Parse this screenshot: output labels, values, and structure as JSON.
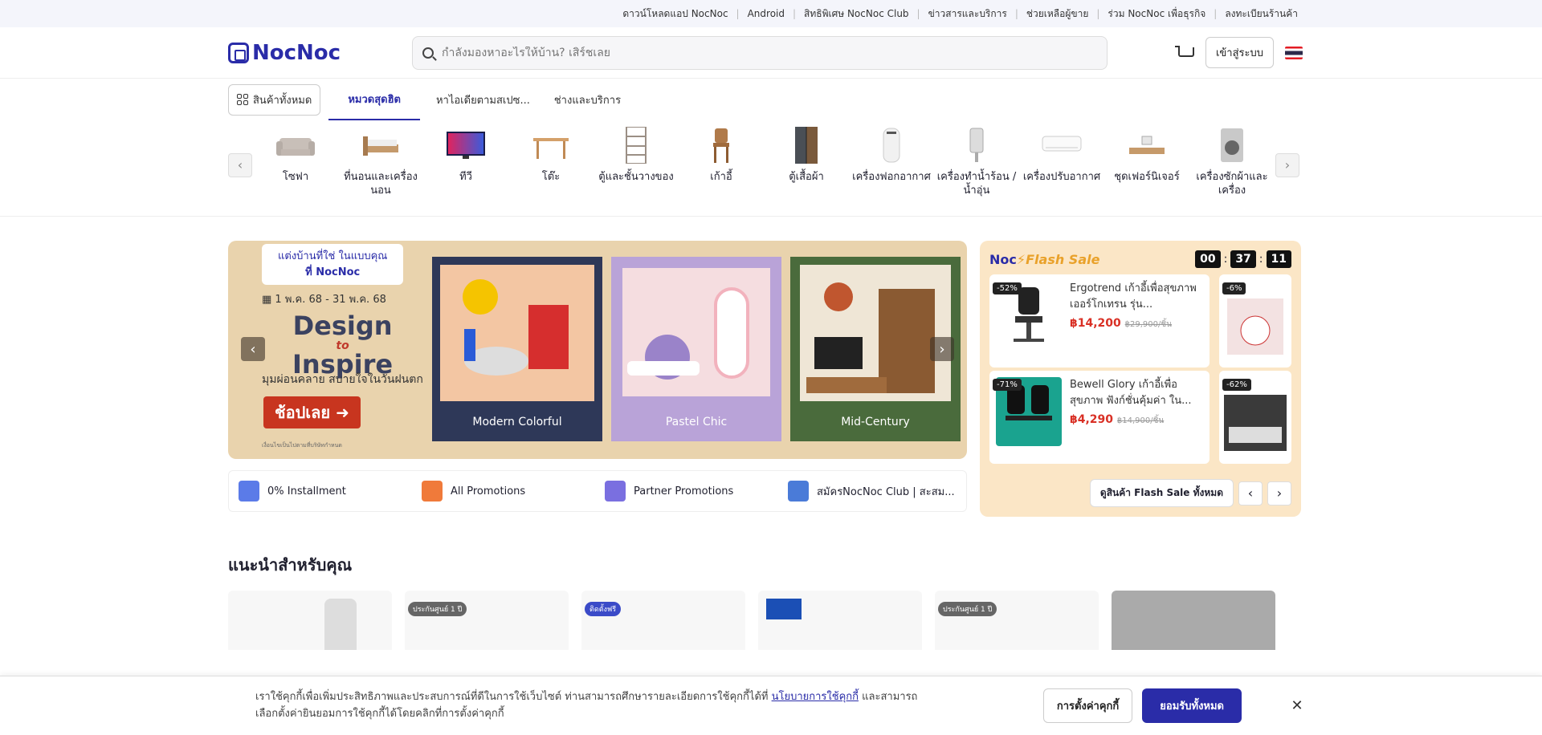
{
  "topbar": {
    "links": [
      "ดาวน์โหลดแอป NocNoc",
      "Android",
      "สิทธิพิเศษ NocNoc Club",
      "ข่าวสารและบริการ",
      "ช่วยเหลือผู้ขาย",
      "ร่วม NocNoc เพื่อธุรกิจ",
      "ลงทะเบียนร้านค้า"
    ]
  },
  "header": {
    "logo": "NocNoc",
    "search_placeholder": "กำลังมองหาอะไรให้บ้าน? เสิร์ชเลย",
    "login_label": "เข้าสู่ระบบ"
  },
  "tabs": {
    "all": "สินค้าทั้งหมด",
    "popular": "หมวดสุดฮิต",
    "ideas": "หาไอเดียตามสเปซ...",
    "services": "ช่างและบริการ"
  },
  "categories": [
    {
      "label": "โซฟา"
    },
    {
      "label": "ที่นอนและเครื่องนอน"
    },
    {
      "label": "ทีวี"
    },
    {
      "label": "โต๊ะ"
    },
    {
      "label": "ตู้และชั้นวางของ"
    },
    {
      "label": "เก้าอี้"
    },
    {
      "label": "ตู้เสื้อผ้า"
    },
    {
      "label": "เครื่องฟอกอากาศ"
    },
    {
      "label": "เครื่องทำน้ำร้อน / น้ำอุ่น"
    },
    {
      "label": "เครื่องปรับอากาศ"
    },
    {
      "label": "ชุดเฟอร์นิเจอร์"
    },
    {
      "label": "เครื่องซักผ้าและเครื่อง"
    }
  ],
  "banner": {
    "tagline": "แต่งบ้านที่ใช่ ในแบบคุณ",
    "tagline2": "ที่ NocNoc",
    "dates": "1 พ.ค. 68 - 31 พ.ค. 68",
    "design": "Design",
    "to": "to",
    "inspire": "Inspire",
    "slogan": "มุมผ่อนคลาย สบายใจในวันฝนตก",
    "shop_btn": "ช้อปเลย",
    "legal": "เงื่อนไขเป็นไปตามที่บริษัทกำหนด",
    "panels": [
      "Modern Colorful",
      "Pastel Chic",
      "Mid-Century"
    ]
  },
  "promos": [
    "0% Installment",
    "All Promotions",
    "Partner Promotions",
    "สมัครNocNoc Club | สะสม..."
  ],
  "flash": {
    "brand": "Noc",
    "title": "Flash Sale",
    "timer": [
      "00",
      "37",
      "11"
    ],
    "items": [
      {
        "badge": "-52%",
        "name": "Ergotrend เก้าอี้เพื่อสุขภาพเออร์โกเทรน รุ่น...",
        "price": "฿14,200",
        "old": "฿29,900/ชิ้น"
      },
      {
        "badge": "-71%",
        "name": "Bewell Glory เก้าอี้เพื่อสุขภาพ ฟังก์ชั่นคุ้มค่า ใน...",
        "price": "฿4,290",
        "old": "฿14,900/ชิ้น"
      }
    ],
    "mini_badges": [
      "-6%",
      "-62%"
    ],
    "all_btn": "ดูสินค้า Flash Sale ทั้งหมด"
  },
  "recommend": {
    "title": "แนะนำสำหรับคุณ",
    "tags": [
      "",
      "ประกันศูนย์ 1 ปี",
      "ติดตั้งฟรี",
      "",
      "ประกันศูนย์ 1 ปี",
      ""
    ]
  },
  "cookie": {
    "text1": "เราใช้คุกกี้เพื่อเพิ่มประสิทธิภาพและประสบการณ์ที่ดีในการใช้เว็บไซต์ ท่านสามารถศึกษารายละเอียดการใช้คุกกี้ได้ที่ ",
    "link": "นโยบายการใช้คุกกี้",
    "text2": " และสามารถเลือกตั้งค่ายินยอมการใช้คุกกี้ได้โดยคลิกที่การตั้งค่าคุกกี้",
    "settings_btn": "การตั้งค่าคุกกี้",
    "accept_btn": "ยอมรับทั้งหมด"
  },
  "colors": {
    "brand": "#2a2ca8",
    "sale_red": "#d93025",
    "flash_bg": "#fbe6c6",
    "banner_bg": "#e9d3ad"
  }
}
